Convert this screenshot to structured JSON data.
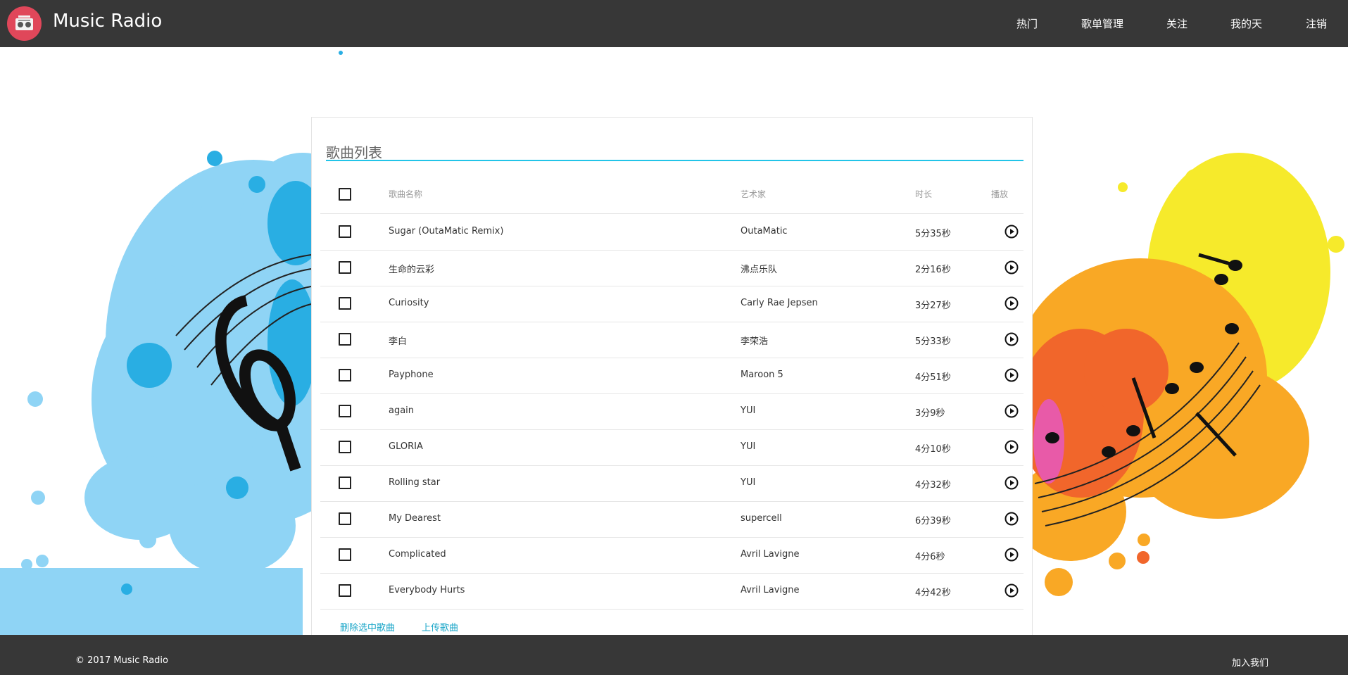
{
  "app": {
    "brand": "Music Radio"
  },
  "nav": {
    "items": [
      {
        "label": "热门"
      },
      {
        "label": "歌单管理"
      },
      {
        "label": "关注"
      },
      {
        "label": "我的天"
      },
      {
        "label": "注销"
      }
    ]
  },
  "card": {
    "title": "歌曲列表",
    "headers": {
      "name": "歌曲名称",
      "artist": "艺术家",
      "duration": "时长",
      "play": "播放"
    },
    "rows": [
      {
        "name": "Sugar (OutaMatic Remix)",
        "artist": "OutaMatic",
        "duration": "5分35秒"
      },
      {
        "name": "生命的云彩",
        "artist": "沸点乐队",
        "duration": "2分16秒"
      },
      {
        "name": "Curiosity",
        "artist": "Carly Rae Jepsen",
        "duration": "3分27秒"
      },
      {
        "name": "李白",
        "artist": "李荣浩",
        "duration": "5分33秒"
      },
      {
        "name": "Payphone",
        "artist": "Maroon 5",
        "duration": "4分51秒"
      },
      {
        "name": "again",
        "artist": "YUI",
        "duration": "3分9秒"
      },
      {
        "name": "GLORIA",
        "artist": "YUI",
        "duration": "4分10秒"
      },
      {
        "name": "Rolling star",
        "artist": "YUI",
        "duration": "4分32秒"
      },
      {
        "name": "My Dearest",
        "artist": "supercell",
        "duration": "6分39秒"
      },
      {
        "name": "Complicated",
        "artist": "Avril Lavigne",
        "duration": "4分6秒"
      },
      {
        "name": "Everybody Hurts",
        "artist": "Avril Lavigne",
        "duration": "4分42秒"
      }
    ],
    "actions": {
      "delete_label": "删除选中歌曲",
      "upload_label": "上传歌曲"
    }
  },
  "footer": {
    "copyright": "© 2017 Music Radio",
    "join": "加入我们"
  },
  "colors": {
    "navbar": "#373737",
    "accent": "#22c4e8",
    "link": "#1aa6c8",
    "logo": "#e0475a"
  },
  "icons": {
    "logo": "radio-icon",
    "play": "play-circle-icon",
    "checkbox": "checkbox-icon"
  }
}
